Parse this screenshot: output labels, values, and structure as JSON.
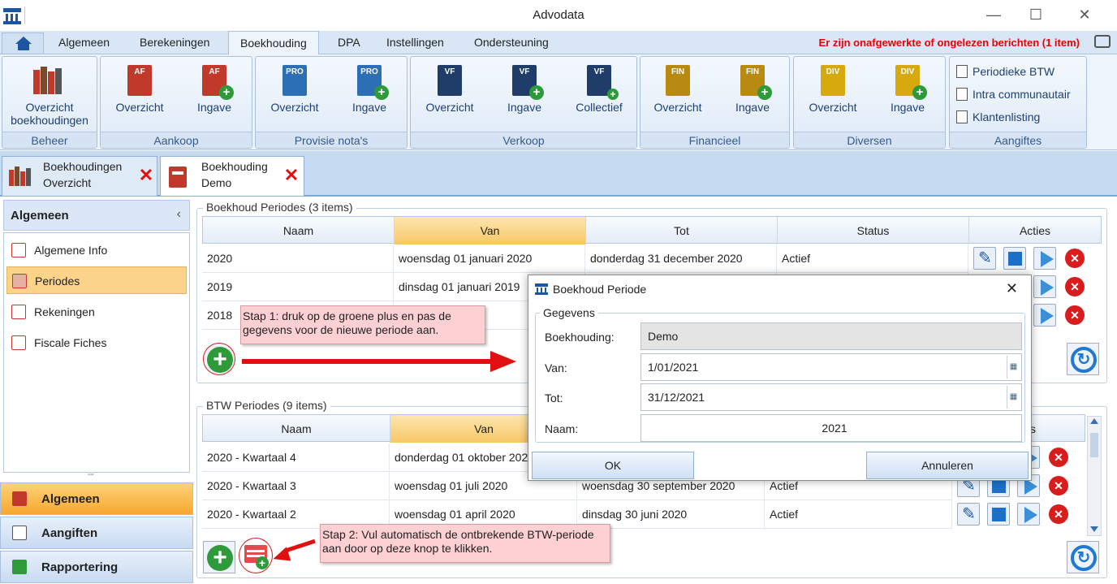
{
  "window": {
    "title": "Advodata",
    "minimize": "—",
    "maximize": "☐",
    "close": "✕"
  },
  "menu": {
    "tabs": [
      "Algemeen",
      "Berekeningen",
      "Boekhouding",
      "DPA",
      "Instellingen",
      "Ondersteuning"
    ],
    "active": "Boekhouding",
    "notice": "Er zijn onafgewerkte of ongelezen berichten (1 item)"
  },
  "ribbon": {
    "beheer": {
      "title": "Beheer",
      "btn": "Overzicht boekhoudingen"
    },
    "aankoop": {
      "title": "Aankoop",
      "icon": "AF",
      "btn1": "Overzicht",
      "btn2": "Ingave"
    },
    "provisie": {
      "title": "Provisie nota's",
      "icon": "PRO",
      "btn1": "Overzicht",
      "btn2": "Ingave"
    },
    "verkoop": {
      "title": "Verkoop",
      "icon": "VF",
      "btn1": "Overzicht",
      "btn2": "Ingave",
      "btn3": "Collectief"
    },
    "financieel": {
      "title": "Financieel",
      "icon": "FIN",
      "btn1": "Overzicht",
      "btn2": "Ingave"
    },
    "diversen": {
      "title": "Diversen",
      "icon": "DIV",
      "btn1": "Overzicht",
      "btn2": "Ingave"
    },
    "aangiftes": {
      "title": "Aangiftes",
      "items": [
        "Periodieke BTW",
        "Intra communautair",
        "Klantenlisting"
      ]
    }
  },
  "doctabs": [
    {
      "line1": "Boekhoudingen",
      "line2": "Overzicht"
    },
    {
      "line1": "Boekhouding",
      "line2": "Demo"
    }
  ],
  "side": {
    "title": "Algemeen",
    "collapse": "‹",
    "items": [
      "Algemene Info",
      "Periodes",
      "Rekeningen",
      "Fiscale Fiches"
    ],
    "selected": "Periodes",
    "grip": "''''",
    "nav": [
      "Algemeen",
      "Aangiften",
      "Rapportering"
    ]
  },
  "boekhoud": {
    "legend": "Boekhoud Periodes (3 items)",
    "cols": [
      "Naam",
      "Van",
      "Tot",
      "Status",
      "Acties"
    ],
    "rows": [
      {
        "naam": "2020",
        "van": "woensdag 01 januari 2020",
        "tot": "donderdag 31 december 2020",
        "status": "Actief"
      },
      {
        "naam": "2019",
        "van": "dinsdag 01 januari 2019",
        "tot": "",
        "status": ""
      },
      {
        "naam": "2018",
        "van": "ober 2018",
        "tot": "",
        "status": ""
      }
    ]
  },
  "btw": {
    "legend": "BTW Periodes (9 items)",
    "cols": [
      "Naam",
      "Van",
      "",
      "",
      "s"
    ],
    "rows": [
      {
        "naam": "2020 - Kwartaal 4",
        "van": "donderdag 01 oktober 2020",
        "tot": "",
        "status": ""
      },
      {
        "naam": "2020 - Kwartaal 3",
        "van": "woensdag 01 juli 2020",
        "tot": "woensdag 30 september 2020",
        "status": "Actief"
      },
      {
        "naam": "2020 - Kwartaal 2",
        "van": "woensdag 01 april 2020",
        "tot": "dinsdag 30 juni 2020",
        "status": "Actief"
      }
    ]
  },
  "notes": {
    "step1": "Stap 1: druk op de groene plus en pas de gegevens voor de nieuwe periode aan.",
    "step2": "Stap 2: Vul automatisch de ontbrekende BTW-periode aan door op deze knop te klikken."
  },
  "dialog": {
    "title": "Boekhoud Periode",
    "close": "✕",
    "legend": "Gegevens",
    "boekhouding_label": "Boekhouding:",
    "boekhouding": "Demo",
    "van_label": "Van:",
    "van": "1/01/2021",
    "tot_label": "Tot:",
    "tot": "31/12/2021",
    "naam_label": "Naam:",
    "naam": "2021",
    "ok": "OK",
    "cancel": "Annuleren"
  },
  "colors": {
    "af": "#c0392b",
    "pro": "#2c6fb4",
    "vf": "#1f3d68",
    "fin": "#b88a12",
    "div": "#d8a80f",
    "accent": "#f8c765",
    "note_bg": "#fdd0d3",
    "arrow": "#e01010"
  }
}
